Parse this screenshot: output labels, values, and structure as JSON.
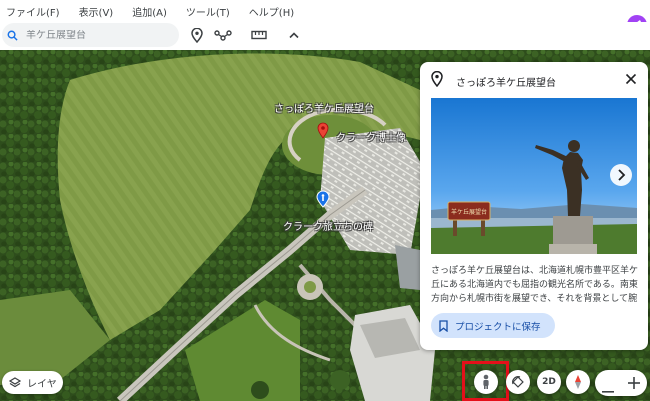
{
  "menu": {
    "file": "ファイル(F)",
    "view": "表示(V)",
    "add": "追加(A)",
    "tools": "ツール(T)",
    "help": "ヘルプ(H)"
  },
  "search": {
    "value": "",
    "placeholder": "羊ケ丘展望台"
  },
  "map_labels": {
    "observatory": "さっぽろ羊ケ丘展望台",
    "statue": "クラーク博士像",
    "monument": "クラーク旅立ちの碑"
  },
  "card": {
    "title": "さっぽろ羊ケ丘展望台",
    "description": "さっぽろ羊ケ丘展望台は、北海道札幌市豊平区羊ケ丘にある北海道内でも屈指の観光名所である。南東方向から札幌市街を展望でき、それを背景として腕",
    "save_label": "プロジェクトに保存",
    "photo_signboard": "羊ケ丘展望台"
  },
  "controls": {
    "layers_label": "レイヤ",
    "view_2d_label": "2D"
  },
  "colors": {
    "accent": "#1a73e8",
    "avatar": "#a142f4",
    "highlight": "#e4101a",
    "save_button_bg": "#d2e3fc",
    "pin_red": "#ea4335"
  },
  "icons": [
    "search-icon",
    "pin-icon",
    "path-icon",
    "ruler-icon",
    "chevron-up-icon",
    "close-icon",
    "chevron-right-icon",
    "bookmark-icon",
    "layers-icon",
    "pegman-icon",
    "rotate-icon",
    "compass-icon",
    "zoom-out-icon",
    "zoom-in-icon",
    "account-icon"
  ]
}
